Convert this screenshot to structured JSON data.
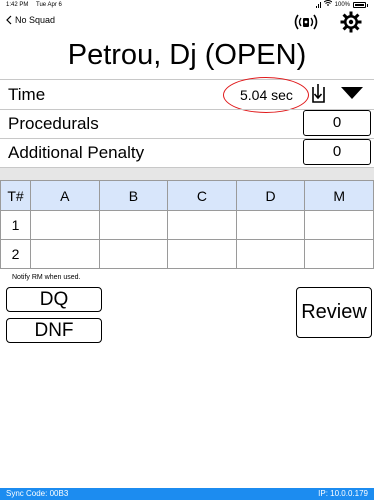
{
  "status_bar": {
    "time": "1:42 PM",
    "date": "Tue Apr 6",
    "battery": "100%"
  },
  "nav": {
    "back_label": "No Squad"
  },
  "athlete": {
    "name": "Petrou, Dj (OPEN)"
  },
  "time_row": {
    "label": "Time",
    "value": "5.04 sec"
  },
  "procedurals": {
    "label": "Procedurals",
    "value": "0"
  },
  "additional_penalty": {
    "label": "Additional Penalty",
    "value": "0"
  },
  "table": {
    "headers": [
      "T#",
      "A",
      "B",
      "C",
      "D",
      "M"
    ],
    "rows": [
      [
        "1",
        "",
        "",
        "",
        "",
        ""
      ],
      [
        "2",
        "",
        "",
        "",
        "",
        ""
      ]
    ]
  },
  "notes": {
    "notify": "Notify RM when used."
  },
  "buttons": {
    "dq": "DQ",
    "dnf": "DNF",
    "review": "Review"
  },
  "footer": {
    "sync": "Sync Code: 00B3",
    "ip": "IP: 10.0.0.179"
  },
  "colors": {
    "accent": "#1c8cf0",
    "header_row": "#d8e6fb",
    "highlight_oval": "#e0191b"
  }
}
